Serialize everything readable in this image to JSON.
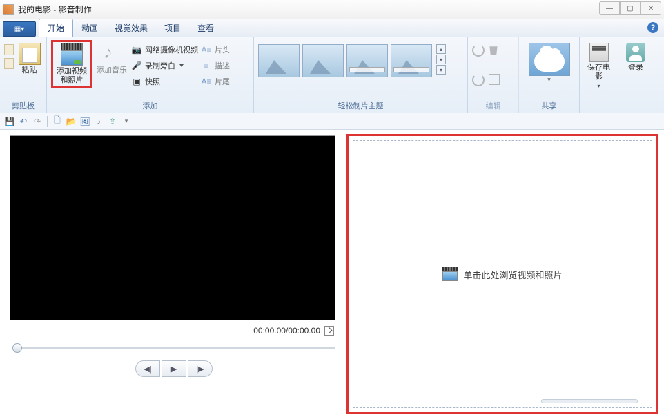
{
  "title": "我的电影 - 影音制作",
  "tabs": {
    "start": "开始",
    "anim": "动画",
    "fx": "视觉效果",
    "proj": "项目",
    "view": "查看"
  },
  "ribbon": {
    "clipboard": {
      "paste": "粘贴",
      "group": "剪贴板"
    },
    "add": {
      "media": "添加视频\n和照片",
      "music": "添加音乐",
      "webcam": "网络摄像机视频",
      "narration": "录制旁白",
      "snapshot": "快照",
      "titletop": "片头",
      "desc": "描述",
      "titleend": "片尾",
      "group": "添加"
    },
    "themes": {
      "group": "轻松制片主题"
    },
    "edit": {
      "group": "编辑"
    },
    "share": {
      "group": "共享"
    },
    "save": "保存电影",
    "login": "登录"
  },
  "player": {
    "time": "00:00.00/00:00.00"
  },
  "dropzone": {
    "text": "单击此处浏览视频和照片"
  }
}
